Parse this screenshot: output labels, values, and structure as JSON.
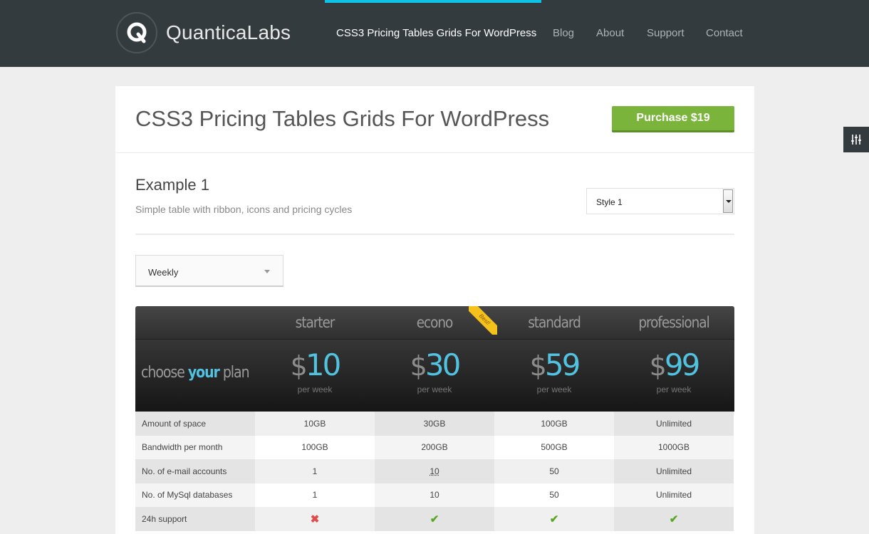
{
  "header": {
    "logo_text": "QuanticaLabs",
    "nav": [
      {
        "label": "CSS3 Pricing Tables Grids For WordPress",
        "active": true
      },
      {
        "label": "Blog"
      },
      {
        "label": "About"
      },
      {
        "label": "Support"
      },
      {
        "label": "Contact"
      }
    ],
    "accent_color": "#10c1e6"
  },
  "page": {
    "title": "CSS3 Pricing Tables Grids For WordPress",
    "purchase_label": "Purchase $19"
  },
  "example": {
    "title": "Example 1",
    "subtitle": "Simple table with ribbon, icons and pricing cycles",
    "style_select": "Style 1",
    "cycle_select": "Weekly"
  },
  "pricing": {
    "choose_prefix": "choose ",
    "choose_highlight": "your",
    "choose_suffix": " plan",
    "ribbon": "Best!",
    "plans": [
      {
        "name": "starter",
        "currency": "$",
        "price": "10",
        "period": "per week"
      },
      {
        "name": "econo",
        "currency": "$",
        "price": "30",
        "period": "per week"
      },
      {
        "name": "standard",
        "currency": "$",
        "price": "59",
        "period": "per week"
      },
      {
        "name": "professional",
        "currency": "$",
        "price": "99",
        "period": "per week"
      }
    ],
    "rows": [
      {
        "label": "Amount of space",
        "values": [
          "10GB",
          "30GB",
          "100GB",
          "Unlimited"
        ]
      },
      {
        "label": "Bandwidth per month",
        "values": [
          "100GB",
          "200GB",
          "500GB",
          "1000GB"
        ]
      },
      {
        "label": "No. of e-mail accounts",
        "values": [
          "1",
          "10",
          "50",
          "Unlimited"
        ]
      },
      {
        "label": "No. of MySql databases",
        "values": [
          "1",
          "10",
          "50",
          "Unlimited"
        ]
      },
      {
        "label": "24h support",
        "values": [
          "no",
          "yes",
          "yes",
          "yes"
        ]
      }
    ],
    "icons": {
      "no": "cross-icon",
      "yes": "check-icon"
    },
    "colors": {
      "price": "#51c3e0",
      "check": "#5aa725",
      "cross": "#e24b4b",
      "ribbon": "#f4c21b",
      "purchase": "#7ab43b"
    }
  }
}
